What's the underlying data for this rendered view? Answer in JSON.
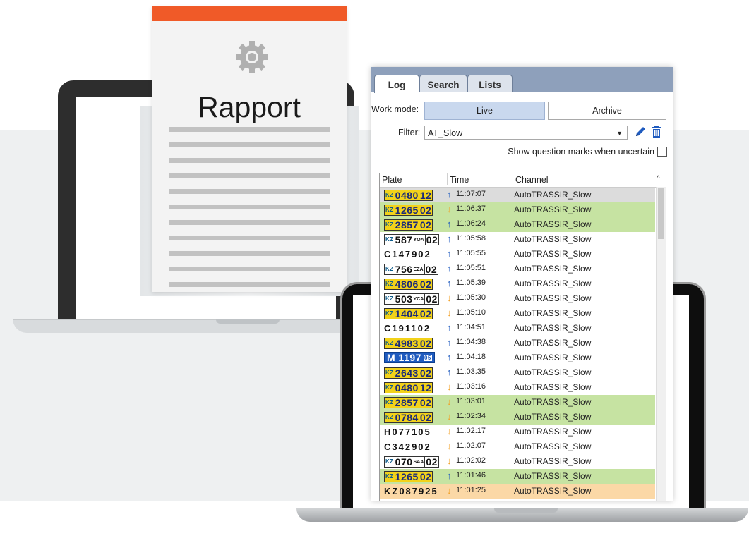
{
  "document": {
    "title": "Rapport",
    "line_count": 11
  },
  "app": {
    "tabs": [
      {
        "label": "Log",
        "active": true
      },
      {
        "label": "Search",
        "active": false
      },
      {
        "label": "Lists",
        "active": false
      }
    ],
    "work_mode_label": "Work mode:",
    "mode_live": "Live",
    "mode_archive": "Archive",
    "filter_label": "Filter:",
    "filter_value": "AT_Slow",
    "uncertain_label": "Show question marks when uncertain",
    "columns": {
      "plate": "Plate",
      "time": "Time",
      "channel": "Channel"
    },
    "colors": {
      "green_row": "#c6e3a2",
      "orange_row": "#fbd8a6",
      "gray_row": "#dcdcdc",
      "up_arrow": "#1f5bbf",
      "down_arrow": "#f2a024"
    },
    "rows": [
      {
        "plate": "048012",
        "style": "yel",
        "dir": "up",
        "time": "11:07:07",
        "channel": "AutoTRASSIR_Slow",
        "bg": "gray"
      },
      {
        "plate": "126502",
        "style": "yel",
        "dir": "down",
        "time": "11:06:37",
        "channel": "AutoTRASSIR_Slow",
        "bg": "green"
      },
      {
        "plate": "285702",
        "style": "yel",
        "dir": "up",
        "time": "11:06:24",
        "channel": "AutoTRASSIR_Slow",
        "bg": "green"
      },
      {
        "plate": "587YOA02",
        "style": "wht",
        "dir": "up",
        "time": "11:05:58",
        "channel": "AutoTRASSIR_Slow",
        "bg": "none"
      },
      {
        "plate": "C147902",
        "style": "txt",
        "dir": "up",
        "time": "11:05:55",
        "channel": "AutoTRASSIR_Slow",
        "bg": "none"
      },
      {
        "plate": "756EZA02",
        "style": "wht",
        "dir": "up",
        "time": "11:05:51",
        "channel": "AutoTRASSIR_Slow",
        "bg": "none"
      },
      {
        "plate": "480602",
        "style": "yel",
        "dir": "up",
        "time": "11:05:39",
        "channel": "AutoTRASSIR_Slow",
        "bg": "none"
      },
      {
        "plate": "503YCA02",
        "style": "wht",
        "dir": "down",
        "time": "11:05:30",
        "channel": "AutoTRASSIR_Slow",
        "bg": "none"
      },
      {
        "plate": "140402",
        "style": "yel",
        "dir": "down",
        "time": "11:05:10",
        "channel": "AutoTRASSIR_Slow",
        "bg": "none"
      },
      {
        "plate": "C191102",
        "style": "txt",
        "dir": "up",
        "time": "11:04:51",
        "channel": "AutoTRASSIR_Slow",
        "bg": "none"
      },
      {
        "plate": "498302",
        "style": "yel",
        "dir": "up",
        "time": "11:04:38",
        "channel": "AutoTRASSIR_Slow",
        "bg": "none"
      },
      {
        "plate": "M 1197 05",
        "style": "blu",
        "dir": "up",
        "time": "11:04:18",
        "channel": "AutoTRASSIR_Slow",
        "bg": "none"
      },
      {
        "plate": "264302",
        "style": "yel",
        "dir": "up",
        "time": "11:03:35",
        "channel": "AutoTRASSIR_Slow",
        "bg": "none"
      },
      {
        "plate": "048012",
        "style": "yel",
        "dir": "down",
        "time": "11:03:16",
        "channel": "AutoTRASSIR_Slow",
        "bg": "none"
      },
      {
        "plate": "285702",
        "style": "yel",
        "dir": "down",
        "time": "11:03:01",
        "channel": "AutoTRASSIR_Slow",
        "bg": "green"
      },
      {
        "plate": "078402",
        "style": "yel",
        "dir": "down",
        "time": "11:02:34",
        "channel": "AutoTRASSIR_Slow",
        "bg": "green"
      },
      {
        "plate": "H077105",
        "style": "txt",
        "dir": "down",
        "time": "11:02:17",
        "channel": "AutoTRASSIR_Slow",
        "bg": "none"
      },
      {
        "plate": "C342902",
        "style": "txt",
        "dir": "down",
        "time": "11:02:07",
        "channel": "AutoTRASSIR_Slow",
        "bg": "none"
      },
      {
        "plate": "070SAA02",
        "style": "wht",
        "dir": "down",
        "time": "11:02:02",
        "channel": "AutoTRASSIR_Slow",
        "bg": "none"
      },
      {
        "plate": "126502",
        "style": "yel",
        "dir": "up",
        "time": "11:01:46",
        "channel": "AutoTRASSIR_Slow",
        "bg": "green"
      },
      {
        "plate": "KZ087925",
        "style": "txt",
        "dir": "down",
        "time": "11:01:25",
        "channel": "AutoTRASSIR_Slow",
        "bg": "orange"
      }
    ]
  }
}
